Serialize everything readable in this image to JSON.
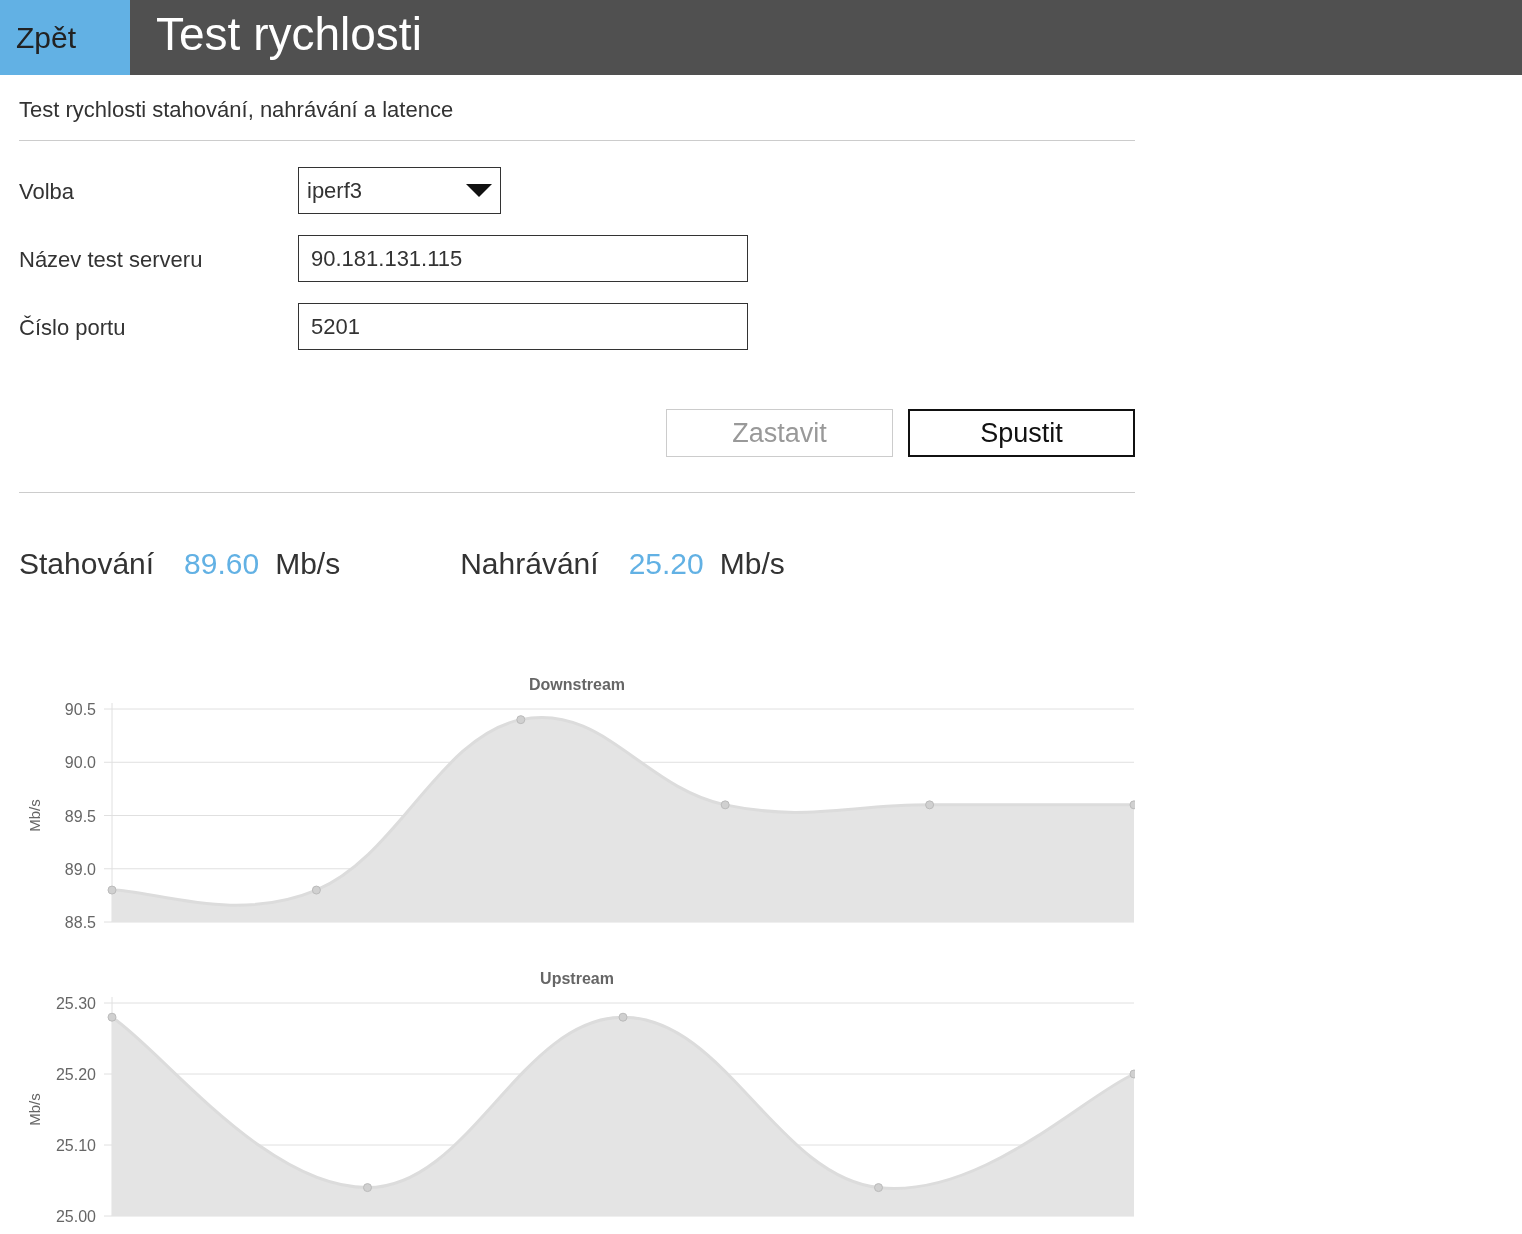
{
  "header": {
    "back_button": "Zpět",
    "title": "Test rychlosti"
  },
  "subtitle": "Test rychlosti stahování, nahrávání a latence",
  "form": [
    {
      "kind": "select",
      "label": "Volba",
      "value": "iperf3"
    },
    {
      "kind": "input",
      "label": "Název test serveru",
      "value": "90.181.131.115"
    },
    {
      "kind": "input",
      "label": "Číslo portu",
      "value": "5201"
    }
  ],
  "buttons": [
    {
      "label": "Zastavit",
      "disabled": true
    },
    {
      "label": "Spustit",
      "disabled": false
    }
  ],
  "results": [
    {
      "label": "Stahování",
      "value": "89.60",
      "unit": "Mb/s"
    },
    {
      "label": "Nahrávání",
      "value": "25.20",
      "unit": "Mb/s"
    }
  ],
  "charts": [
    {
      "chart_data": {
        "type": "area",
        "title": "Downstream",
        "ylabel": "Mb/s",
        "ylim": [
          88.5,
          90.5
        ],
        "yticks": [
          {
            "value": 88.5,
            "label": "88.5"
          },
          {
            "value": 89,
            "label": "89.0"
          },
          {
            "value": 89.5,
            "label": "89.5"
          },
          {
            "value": 90,
            "label": "90.0"
          },
          {
            "value": 90.5,
            "label": "90.5"
          }
        ],
        "grid": true,
        "series": [
          {
            "color": "#dcdcdc",
            "values": [
              88.8,
              88.8,
              90.4,
              89.6,
              89.6,
              89.6
            ]
          }
        ]
      }
    },
    {
      "chart_data": {
        "type": "area",
        "title": "Upstream",
        "ylabel": "Mb/s",
        "ylim": [
          25.0,
          25.3
        ],
        "yticks": [
          {
            "value": 25.0,
            "label": "25.00"
          },
          {
            "value": 25.1,
            "label": "25.10"
          },
          {
            "value": 25.2,
            "label": "25.20"
          },
          {
            "value": 25.3,
            "label": "25.30"
          }
        ],
        "grid": true,
        "series": [
          {
            "color": "#dcdcdc",
            "values": [
              25.28,
              25.04,
              25.28,
              25.04,
              25.2
            ]
          }
        ]
      }
    }
  ]
}
